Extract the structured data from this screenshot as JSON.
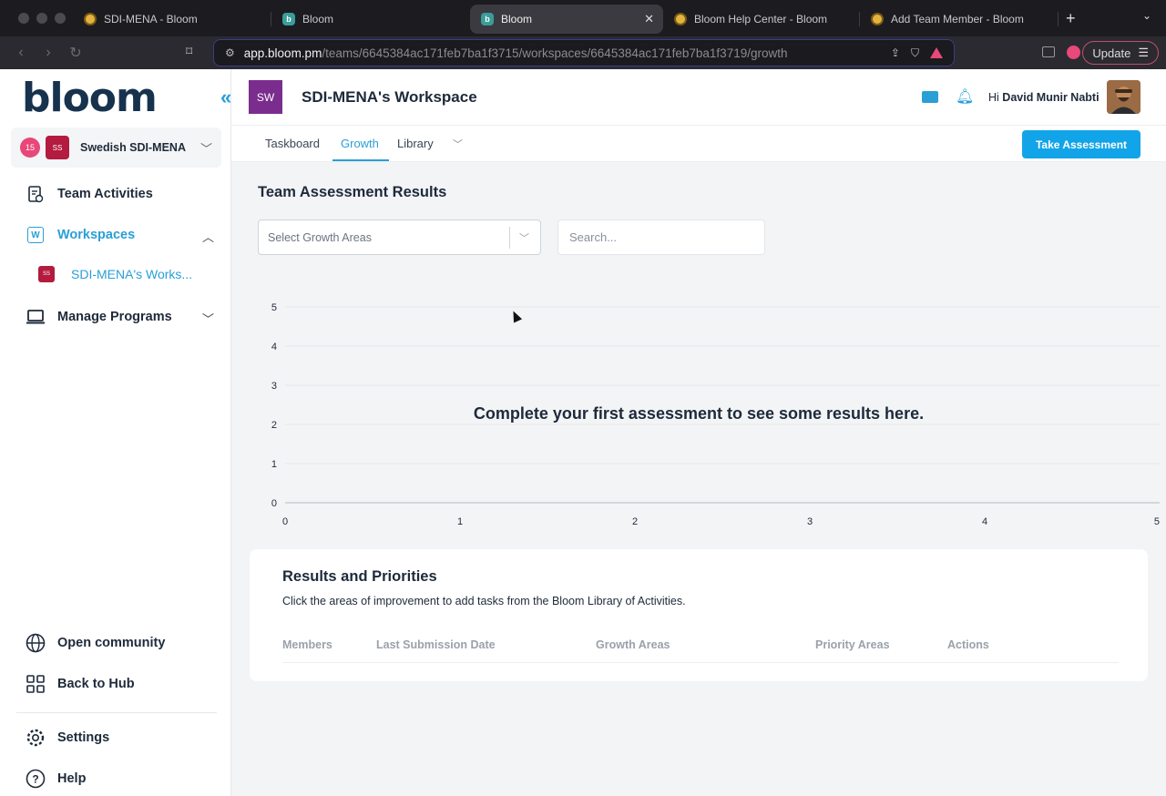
{
  "browser": {
    "tabs": [
      {
        "title": "SDI-MENA - Bloom",
        "icon": "sun-favicon-icon"
      },
      {
        "title": "Bloom",
        "icon": "bloom-favicon-icon"
      },
      {
        "title": "Bloom",
        "icon": "bloom-favicon-icon",
        "active": true
      },
      {
        "title": "Bloom Help Center - Bloom",
        "icon": "sun-favicon-icon"
      },
      {
        "title": "Add Team Member - Bloom",
        "icon": "sun-favicon-icon"
      }
    ],
    "url_host": "app.bloom.pm",
    "url_path": "/teams/6645384ac171feb7ba1f3715/workspaces/6645384ac171feb7ba1f3719/growth",
    "update_label": "Update",
    "favicon_letter": "b"
  },
  "sidebar": {
    "logo": "bloom",
    "team": {
      "count": "15",
      "initials": "SS",
      "name": "Swedish SDI-MENA"
    },
    "items": [
      {
        "label": "Team Activities"
      },
      {
        "label": "Workspaces"
      },
      {
        "label": "Manage Programs"
      }
    ],
    "workspace_sub": {
      "initials": "SS",
      "label": "SDI-MENA's Works..."
    },
    "bottom": [
      {
        "label": "Open community"
      },
      {
        "label": "Back to Hub"
      },
      {
        "label": "Settings"
      },
      {
        "label": "Help"
      }
    ],
    "workspace_letter": "W"
  },
  "header": {
    "ws_initials": "SW",
    "title": "SDI-MENA's Workspace",
    "greeting_prefix": "Hi",
    "user_name": "David Munir Nabti"
  },
  "tabs": {
    "items": [
      "Taskboard",
      "Growth",
      "Library"
    ],
    "active": "Growth",
    "take_assessment": "Take Assessment"
  },
  "assessment": {
    "title": "Team Assessment Results",
    "select_placeholder": "Select Growth Areas",
    "search_placeholder": "Search...",
    "empty_message": "Complete your first assessment to see some results here."
  },
  "chart_data": {
    "type": "line",
    "x_ticks": [
      "0",
      "1",
      "2",
      "3",
      "4",
      "5"
    ],
    "y_ticks": [
      "0",
      "1",
      "2",
      "3",
      "4",
      "5"
    ],
    "xlim": [
      0,
      5
    ],
    "ylim": [
      0,
      5
    ],
    "grid": true,
    "series": []
  },
  "results": {
    "title": "Results and Priorities",
    "subtitle": "Click the areas of improvement to add tasks from the Bloom Library of Activities.",
    "columns": [
      "Members",
      "Last Submission Date",
      "Growth Areas",
      "Priority Areas",
      "Actions"
    ]
  },
  "colors": {
    "accent": "#12a4e8",
    "brand_dark": "#17324d",
    "team_badge": "#b31b3f",
    "workspace_badge": "#7b2d8e"
  }
}
